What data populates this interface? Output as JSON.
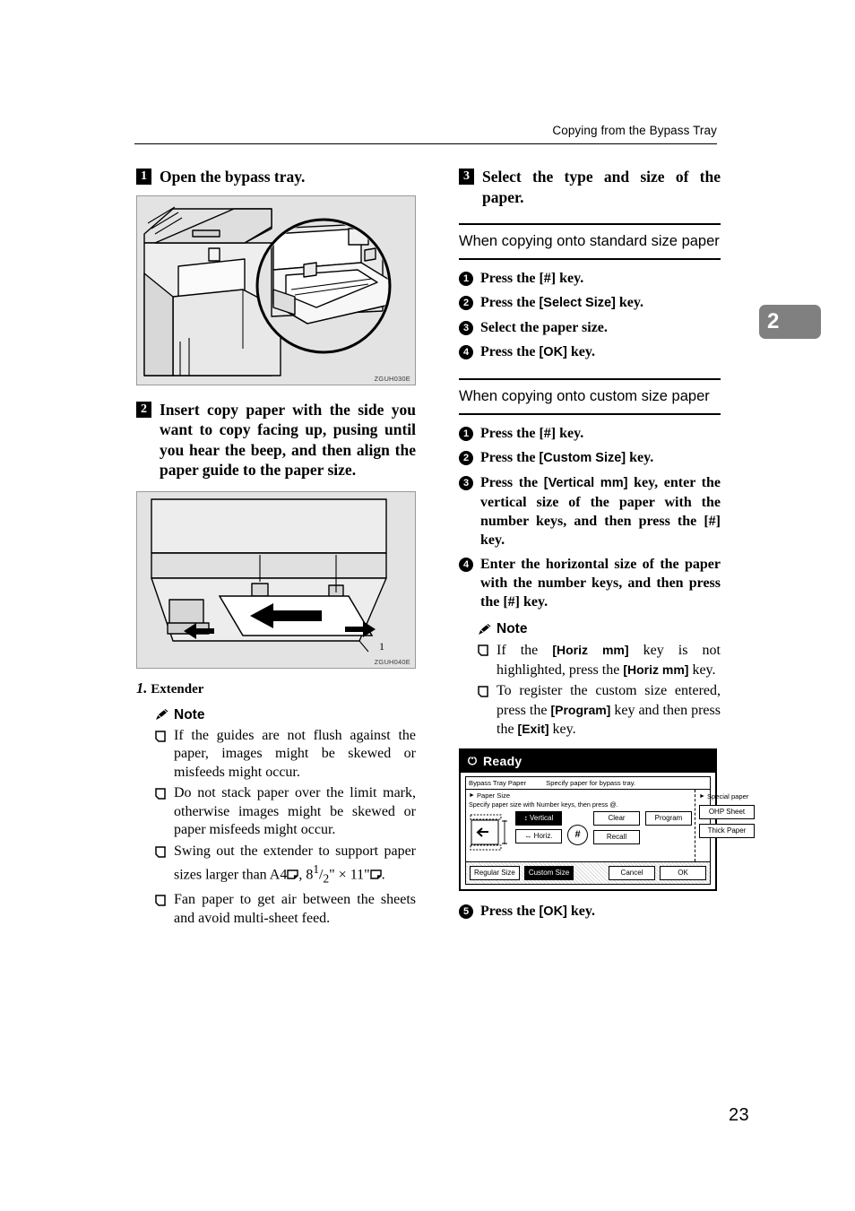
{
  "header": {
    "running_head": "Copying from the Bypass Tray",
    "chapter_tab": "2",
    "page_number": "23"
  },
  "left_column": {
    "step1": {
      "number": "1",
      "text": "Open the bypass tray."
    },
    "figure1": {
      "code": "ZGUH030E"
    },
    "step2": {
      "number": "2",
      "text": "Insert copy paper with the side you want to copy facing up, pusing until you hear the beep, and then align the paper guide to the paper size."
    },
    "figure2": {
      "code": "ZGUH040E",
      "callout": "1"
    },
    "caption": {
      "number": "1.",
      "label": "Extender"
    },
    "note": {
      "title": "Note",
      "items": [
        "If the guides are not flush against the paper, images might be skewed or misfeeds might occur.",
        "Do not stack paper over the limit mark, otherwise images might be skewed or paper misfeeds might occur.",
        "Fan paper to get air between the sheets and avoid multi-sheet feed.",
        "Swing out the extender to support paper sizes larger than",
        "Fan paper to get air between the sheets and avoid multi-sheet feed."
      ],
      "item3_prefix": "Swing out the extender to support paper sizes larger than ",
      "item3_a4": "A4",
      "item3_mid": ", 8",
      "item3_sup": "1",
      "item3_sub": "2",
      "item3_inch": "\" × 11\"",
      "item3_end": "."
    }
  },
  "right_column": {
    "step3": {
      "number": "3",
      "text": "Select the type and size of the paper."
    },
    "section_standard": {
      "heading": "When copying onto standard size paper",
      "steps": [
        {
          "num": "1",
          "parts": [
            {
              "t": "Press the ",
              "s": "plain"
            },
            {
              "t": "[#]",
              "s": "key-serif"
            },
            {
              "t": " key.",
              "s": "plain"
            }
          ]
        },
        {
          "num": "2",
          "parts": [
            {
              "t": "Press the ",
              "s": "plain"
            },
            {
              "t": "[Select Size]",
              "s": "key"
            },
            {
              "t": " key.",
              "s": "plain"
            }
          ]
        },
        {
          "num": "3",
          "parts": [
            {
              "t": "Select the paper size.",
              "s": "plain"
            }
          ]
        },
        {
          "num": "4",
          "parts": [
            {
              "t": "Press the ",
              "s": "plain"
            },
            {
              "t": "[OK]",
              "s": "key"
            },
            {
              "t": " key.",
              "s": "plain"
            }
          ]
        }
      ]
    },
    "section_custom": {
      "heading": "When copying onto custom size paper",
      "steps": [
        {
          "num": "1",
          "parts": [
            {
              "t": "Press the ",
              "s": "plain"
            },
            {
              "t": "[#]",
              "s": "key-serif"
            },
            {
              "t": " key.",
              "s": "plain"
            }
          ]
        },
        {
          "num": "2",
          "parts": [
            {
              "t": "Press the ",
              "s": "plain"
            },
            {
              "t": "[Custom Size]",
              "s": "key"
            },
            {
              "t": " key.",
              "s": "plain"
            }
          ]
        },
        {
          "num": "3",
          "parts": [
            {
              "t": "Press the ",
              "s": "plain"
            },
            {
              "t": "[Vertical mm]",
              "s": "key"
            },
            {
              "t": " key, enter the vertical size of the paper with the number keys, and then press the [#] key.",
              "s": "plain"
            }
          ]
        },
        {
          "num": "4",
          "parts": [
            {
              "t": "Enter the horizontal size of the paper with the number keys, and then press the [#] key.",
              "s": "plain"
            }
          ]
        }
      ],
      "note": {
        "title": "Note",
        "items": [
          {
            "parts": [
              {
                "t": "If the ",
                "s": "plain"
              },
              {
                "t": "[Horiz mm]",
                "s": "key"
              },
              {
                "t": " key is not highlighted, press the ",
                "s": "plain"
              },
              {
                "t": "[Horiz mm]",
                "s": "key"
              },
              {
                "t": " key.",
                "s": "plain"
              }
            ]
          },
          {
            "parts": [
              {
                "t": "To register the custom size entered, press the ",
                "s": "plain"
              },
              {
                "t": "[Program]",
                "s": "key"
              },
              {
                "t": " key and then press the ",
                "s": "plain"
              },
              {
                "t": "[Exit]",
                "s": "key"
              },
              {
                "t": " key.",
                "s": "plain"
              }
            ]
          }
        ]
      },
      "final_step": {
        "num": "5",
        "parts": [
          {
            "t": "Press the ",
            "s": "plain"
          },
          {
            "t": "[OK]",
            "s": "key"
          },
          {
            "t": " key.",
            "s": "plain"
          }
        ]
      }
    },
    "lcd_panel": {
      "status": "Ready",
      "status_icon": "power-icon",
      "title_bar_label": "Bypass Tray Paper",
      "title_bar_hint": "Specify paper for bypass tray.",
      "paper_size_label": "Paper Size",
      "paper_size_hint": "Specify paper size with Number keys, then press @.",
      "special_paper_label": "Special paper",
      "buttons": {
        "vertical": "Vertical",
        "horiz": "Horiz.",
        "hash": "#",
        "clear": "Clear",
        "program": "Program",
        "recall": "Recall",
        "ohp_sheet": "OHP Sheet",
        "thick_paper": "Thick Paper",
        "regular_size": "Regular Size",
        "custom_size": "Custom Size",
        "cancel": "Cancel",
        "ok": "OK"
      }
    }
  }
}
